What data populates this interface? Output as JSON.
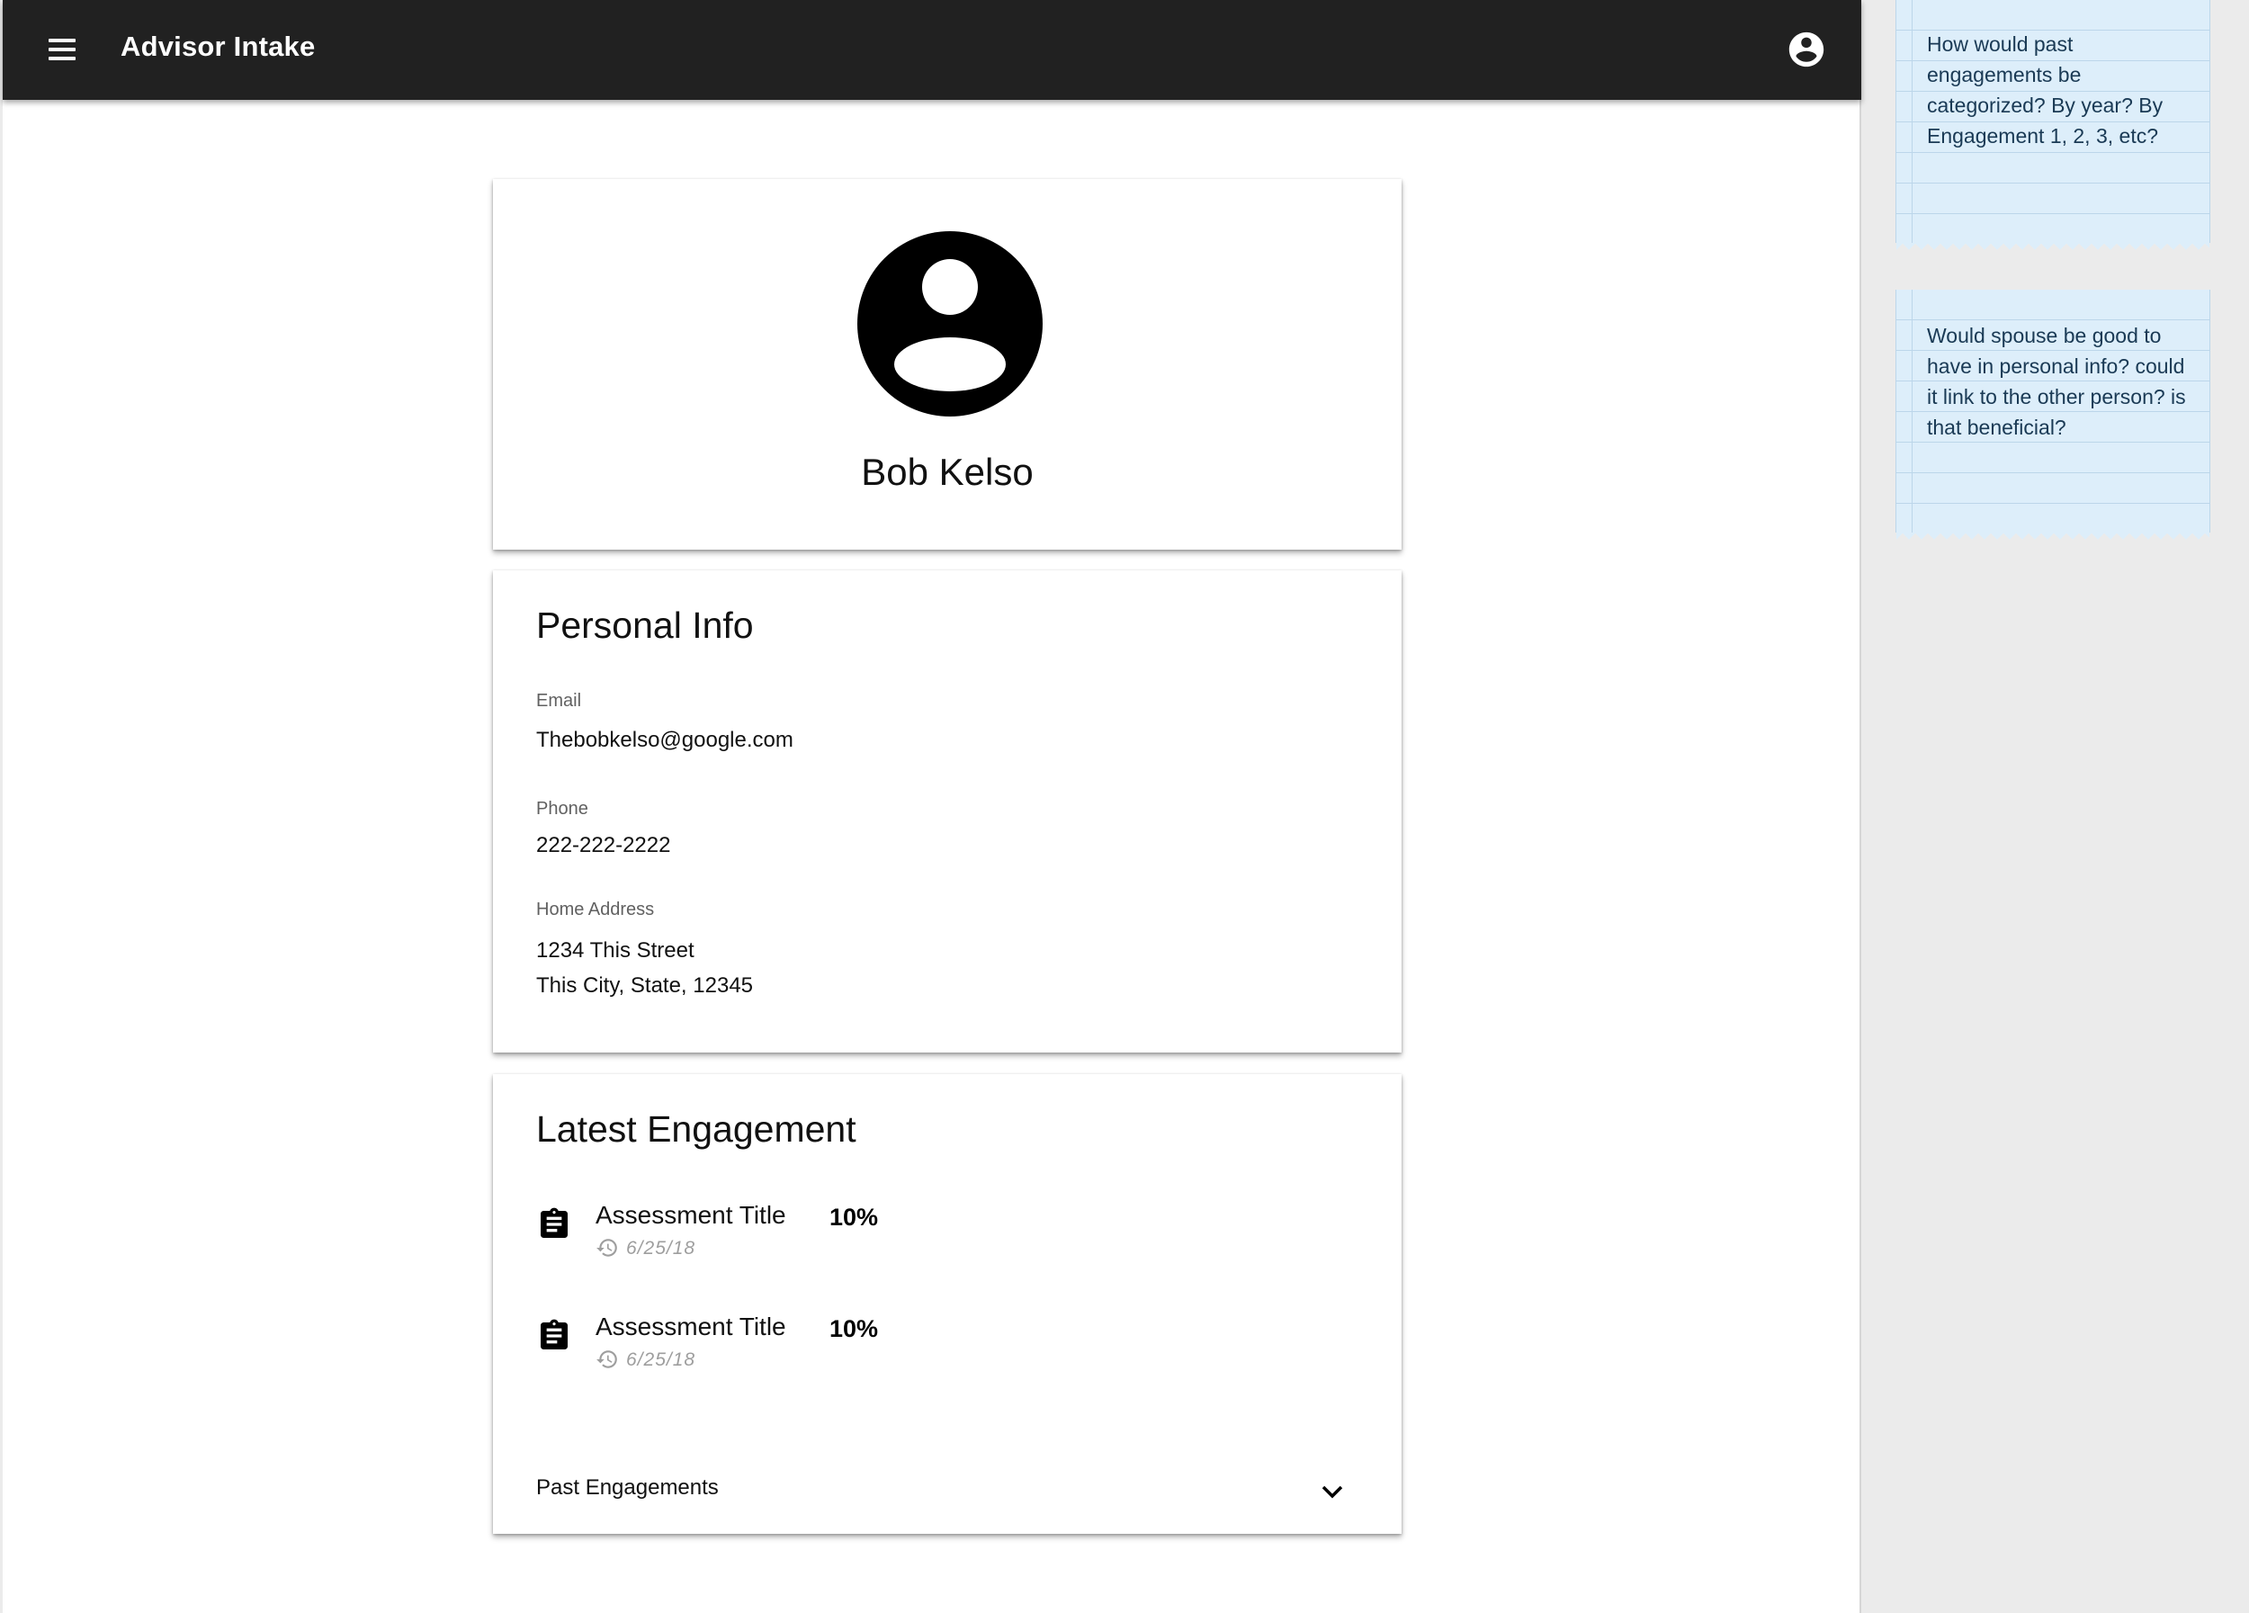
{
  "app_bar": {
    "title": "Advisor Intake",
    "menu_icon": "menu-icon",
    "account_icon": "account-circle-icon"
  },
  "profile": {
    "avatar_icon": "account-circle-icon",
    "name": "Bob Kelso"
  },
  "personal_info": {
    "title": "Personal Info",
    "email_label": "Email",
    "email_value": "Thebobkelso@google.com",
    "phone_label": "Phone",
    "phone_value": "222-222-2222",
    "address_label": "Home Address",
    "address_line1": "1234 This Street",
    "address_line2": "This City, State, 12345"
  },
  "latest_engagement": {
    "title": "Latest Engagement",
    "items": [
      {
        "title": "Assessment Title",
        "date": "6/25/18",
        "percent": "10%",
        "icon": "assignment-icon",
        "date_icon": "history-icon"
      },
      {
        "title": "Assessment Title",
        "date": "6/25/18",
        "percent": "10%",
        "icon": "assignment-icon",
        "date_icon": "history-icon"
      }
    ],
    "past_label": "Past Engagements",
    "past_icon": "chevron-down-icon"
  },
  "notes": [
    {
      "text": "How would past engagements be categorized? By year? By Engagement 1, 2, 3, etc?"
    },
    {
      "text": "Would spouse be good to have in personal info? could it link to the other person? is that beneficial?"
    }
  ],
  "colors": {
    "app_bar": "#212121",
    "note_background": "#ddeefa",
    "page_background": "#ebebeb"
  }
}
